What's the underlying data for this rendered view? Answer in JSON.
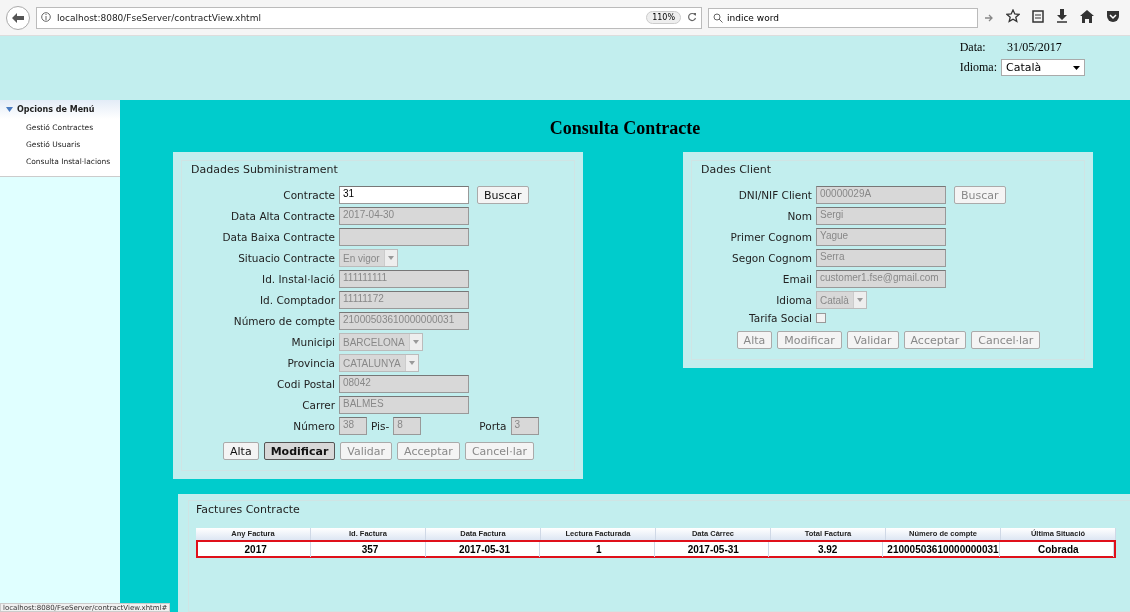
{
  "browser": {
    "url": "localhost:8080/FseServer/contractView.xhtml",
    "zoom": "110%",
    "search": "indice word"
  },
  "header": {
    "date_label": "Data:",
    "date": "31/05/2017",
    "language_label": "Idioma:",
    "language": "Català"
  },
  "sidebar": {
    "title": "Opcions de Menú",
    "expanded": true,
    "items": [
      "Gestió Contractes",
      "Gestió Usuaris",
      "Consulta Instal·lacions"
    ]
  },
  "page_title": "Consulta Contracte",
  "supply": {
    "title": "Dadades Subministrament",
    "fields": [
      {
        "label": "Contracte",
        "kind": "input",
        "value": "31",
        "disabled": false,
        "button": {
          "label": "Buscar",
          "disabled": false
        }
      },
      {
        "label": "Data Alta Contracte",
        "kind": "input",
        "value": "2017-04-30",
        "disabled": true
      },
      {
        "label": "Data Baixa Contracte",
        "kind": "input",
        "disabled": true
      },
      {
        "label": "Situacio Contracte",
        "kind": "select",
        "value": "En vigor",
        "disabled": true
      },
      {
        "label": "Id. Instal·lació",
        "kind": "input",
        "value": "111111111",
        "disabled": true
      },
      {
        "label": "Id. Comptador",
        "kind": "input",
        "value": "11111172",
        "disabled": true
      },
      {
        "label": "Número de compte",
        "kind": "input",
        "value": "21000503610000000031",
        "disabled": true
      },
      {
        "label": "Municipi",
        "kind": "select",
        "value": "BARCELONA",
        "disabled": true
      },
      {
        "label": "Provincia",
        "kind": "select",
        "value": "CATALUNYA",
        "disabled": true
      },
      {
        "label": "Codi Postal",
        "kind": "input",
        "value": "08042",
        "disabled": true
      },
      {
        "label": "Carrer",
        "kind": "input",
        "value": "BALMES",
        "disabled": true
      }
    ],
    "address": [
      {
        "label": "Número",
        "value": "38",
        "disabled": true
      },
      {
        "label": "Pis-",
        "value": "8",
        "disabled": true
      },
      {
        "label": "Porta",
        "value": "3",
        "disabled": true
      }
    ],
    "buttons": [
      {
        "label": "Alta",
        "disabled": false,
        "focused": false
      },
      {
        "label": "Modificar",
        "disabled": false,
        "focused": true
      },
      {
        "label": "Validar",
        "disabled": true,
        "focused": false
      },
      {
        "label": "Acceptar",
        "disabled": true,
        "focused": false
      },
      {
        "label": "Cancel·lar",
        "disabled": true,
        "focused": false
      }
    ]
  },
  "client": {
    "title": "Dades Client",
    "fields": [
      {
        "label": "DNI/NIF Client",
        "kind": "input",
        "value": "00000029A",
        "disabled": true,
        "button": {
          "label": "Buscar",
          "disabled": true
        }
      },
      {
        "label": "Nom",
        "kind": "input",
        "value": "Sergi",
        "disabled": true
      },
      {
        "label": "Primer Cognom",
        "kind": "input",
        "value": "Yague",
        "disabled": true
      },
      {
        "label": "Segon Cognom",
        "kind": "input",
        "value": "Serra",
        "disabled": true
      },
      {
        "label": "Email",
        "kind": "input",
        "value": "customer1.fse@gmail.com",
        "disabled": true
      },
      {
        "label": "Idioma",
        "kind": "select",
        "value": "Català",
        "disabled": true
      },
      {
        "label": "Tarifa Social",
        "kind": "checkbox",
        "checked": false,
        "disabled": true
      }
    ],
    "buttons": [
      {
        "label": "Alta",
        "disabled": true,
        "focused": false
      },
      {
        "label": "Modificar",
        "disabled": true,
        "focused": false
      },
      {
        "label": "Validar",
        "disabled": true,
        "focused": false
      },
      {
        "label": "Acceptar",
        "disabled": true,
        "focused": false
      },
      {
        "label": "Cancel·lar",
        "disabled": true,
        "focused": false
      }
    ]
  },
  "invoices": {
    "title": "Factures Contracte",
    "columns": [
      "Any Factura",
      "Id. Factura",
      "Data Factura",
      "Lectura Facturada",
      "Data Càrrec",
      "Total Factura",
      "Número de compte",
      "Última Situació"
    ],
    "rows": [
      {
        "cells": [
          "2017",
          "357",
          "2017-05-31",
          "1",
          "2017-05-31",
          "3.92",
          "21000503610000000031",
          "Cobrada"
        ],
        "selected": true
      }
    ]
  },
  "status_bar": "localhost:8080/FseServer/contractView.xhtml#"
}
